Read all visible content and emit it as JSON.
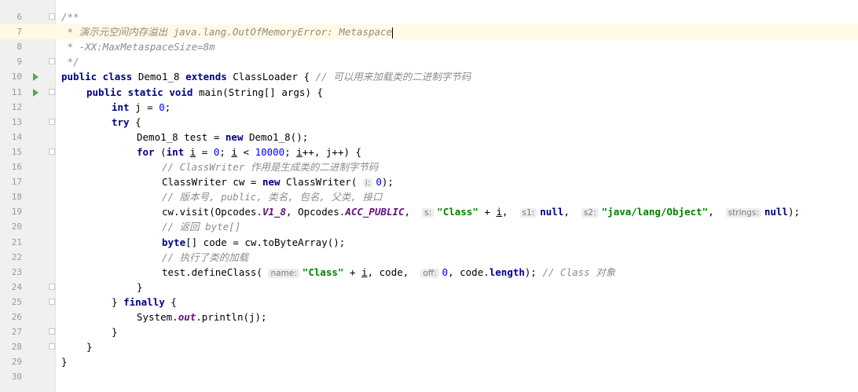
{
  "editor": {
    "current_line": 7,
    "lines": [
      {
        "n": "6",
        "run": false,
        "fold": true,
        "indent": 0,
        "tokens": [
          [
            "cm",
            "/**"
          ]
        ]
      },
      {
        "n": "7",
        "run": false,
        "fold": false,
        "indent": 0,
        "tokens": [
          [
            "cm",
            " * 演示元空间内存溢出 java.lang.OutOfMemoryError: Metaspace"
          ]
        ]
      },
      {
        "n": "8",
        "run": false,
        "fold": false,
        "indent": 0,
        "tokens": [
          [
            "cm",
            " * -XX:MaxMetaspaceSize=8m"
          ]
        ]
      },
      {
        "n": "9",
        "run": false,
        "fold": true,
        "indent": 0,
        "tokens": [
          [
            "cm",
            " */"
          ]
        ]
      },
      {
        "n": "10",
        "run": true,
        "fold": false,
        "indent": 0,
        "tokens": [
          [
            "kw",
            "public class "
          ],
          [
            "",
            "Demo1_8 "
          ],
          [
            "kw",
            "extends "
          ],
          [
            "",
            "ClassLoader { "
          ],
          [
            "cm",
            "// 可以用来加载类的二进制字节码"
          ]
        ]
      },
      {
        "n": "11",
        "run": true,
        "fold": true,
        "indent": 1,
        "tokens": [
          [
            "kw",
            "public static void "
          ],
          [
            "",
            "main(String[] args) {"
          ]
        ]
      },
      {
        "n": "12",
        "run": false,
        "fold": false,
        "indent": 2,
        "tokens": [
          [
            "kw",
            "int "
          ],
          [
            "",
            "j = "
          ],
          [
            "num",
            "0"
          ],
          [
            "",
            ";"
          ]
        ]
      },
      {
        "n": "13",
        "run": false,
        "fold": true,
        "indent": 2,
        "tokens": [
          [
            "kw",
            "try "
          ],
          [
            "",
            "{"
          ]
        ]
      },
      {
        "n": "14",
        "run": false,
        "fold": false,
        "indent": 3,
        "tokens": [
          [
            "",
            "Demo1_8 test = "
          ],
          [
            "kw",
            "new "
          ],
          [
            "",
            "Demo1_8();"
          ]
        ]
      },
      {
        "n": "15",
        "run": false,
        "fold": true,
        "indent": 3,
        "tokens": [
          [
            "kw",
            "for "
          ],
          [
            "",
            "("
          ],
          [
            "kw",
            "int "
          ],
          [
            "und",
            "i"
          ],
          [
            "",
            " = "
          ],
          [
            "num",
            "0"
          ],
          [
            "",
            "; "
          ],
          [
            "und",
            "i"
          ],
          [
            "",
            " < "
          ],
          [
            "num",
            "10000"
          ],
          [
            "",
            "; "
          ],
          [
            "und",
            "i"
          ],
          [
            "",
            "++, j++) {"
          ]
        ]
      },
      {
        "n": "16",
        "run": false,
        "fold": false,
        "indent": 4,
        "tokens": [
          [
            "cm",
            "// ClassWriter 作用是生成类的二进制字节码"
          ]
        ]
      },
      {
        "n": "17",
        "run": false,
        "fold": false,
        "indent": 4,
        "tokens": [
          [
            "",
            "ClassWriter cw = "
          ],
          [
            "kw",
            "new "
          ],
          [
            "",
            "ClassWriter( "
          ],
          [
            "hint",
            "i:"
          ],
          [
            "num",
            "0"
          ],
          [
            "",
            ");"
          ]
        ]
      },
      {
        "n": "18",
        "run": false,
        "fold": false,
        "indent": 4,
        "tokens": [
          [
            "cm",
            "// 版本号, public, 类名, 包名, 父类, 接口"
          ]
        ]
      },
      {
        "n": "19",
        "run": false,
        "fold": false,
        "indent": 4,
        "tokens": [
          [
            "",
            "cw.visit(Opcodes."
          ],
          [
            "static",
            "V1_8"
          ],
          [
            "",
            ", Opcodes."
          ],
          [
            "static",
            "ACC_PUBLIC"
          ],
          [
            "",
            ",  "
          ],
          [
            "hint",
            "s:"
          ],
          [
            "str",
            "\"Class\""
          ],
          [
            "",
            " + "
          ],
          [
            "und",
            "i"
          ],
          [
            "",
            ",  "
          ],
          [
            "hint",
            "s1:"
          ],
          [
            "kw",
            "null"
          ],
          [
            "",
            ",  "
          ],
          [
            "hint",
            "s2:"
          ],
          [
            "str",
            "\"java/lang/Object\""
          ],
          [
            "",
            ",  "
          ],
          [
            "hint",
            "strings:"
          ],
          [
            "kw",
            "null"
          ],
          [
            "",
            ");"
          ]
        ]
      },
      {
        "n": "20",
        "run": false,
        "fold": false,
        "indent": 4,
        "tokens": [
          [
            "cm",
            "// 返回 byte[]"
          ]
        ]
      },
      {
        "n": "21",
        "run": false,
        "fold": false,
        "indent": 4,
        "tokens": [
          [
            "kw",
            "byte"
          ],
          [
            "",
            "[] code = cw.toByteArray();"
          ]
        ]
      },
      {
        "n": "22",
        "run": false,
        "fold": false,
        "indent": 4,
        "tokens": [
          [
            "cm",
            "// 执行了类的加载"
          ]
        ]
      },
      {
        "n": "23",
        "run": false,
        "fold": false,
        "indent": 4,
        "tokens": [
          [
            "",
            "test.defineClass( "
          ],
          [
            "hint",
            "name:"
          ],
          [
            "str",
            "\"Class\""
          ],
          [
            "",
            " + "
          ],
          [
            "und",
            "i"
          ],
          [
            "",
            ", code,  "
          ],
          [
            "hint",
            "off:"
          ],
          [
            "num",
            "0"
          ],
          [
            "",
            ", code."
          ],
          [
            "kw",
            "length"
          ],
          [
            "",
            "); "
          ],
          [
            "cm",
            "// Class 对象"
          ]
        ]
      },
      {
        "n": "24",
        "run": false,
        "fold": true,
        "indent": 3,
        "tokens": [
          [
            "",
            "}"
          ]
        ]
      },
      {
        "n": "25",
        "run": false,
        "fold": true,
        "indent": 2,
        "tokens": [
          [
            "",
            "} "
          ],
          [
            "kw",
            "finally "
          ],
          [
            "",
            "{"
          ]
        ]
      },
      {
        "n": "26",
        "run": false,
        "fold": false,
        "indent": 3,
        "tokens": [
          [
            "",
            "System."
          ],
          [
            "static",
            "out"
          ],
          [
            "",
            ".println(j);"
          ]
        ]
      },
      {
        "n": "27",
        "run": false,
        "fold": true,
        "indent": 2,
        "tokens": [
          [
            "",
            "}"
          ]
        ]
      },
      {
        "n": "28",
        "run": false,
        "fold": true,
        "indent": 1,
        "tokens": [
          [
            "",
            "}"
          ]
        ]
      },
      {
        "n": "29",
        "run": false,
        "fold": false,
        "indent": 0,
        "tokens": [
          [
            "",
            "}"
          ]
        ]
      },
      {
        "n": "30",
        "run": false,
        "fold": false,
        "indent": 0,
        "tokens": []
      }
    ]
  }
}
